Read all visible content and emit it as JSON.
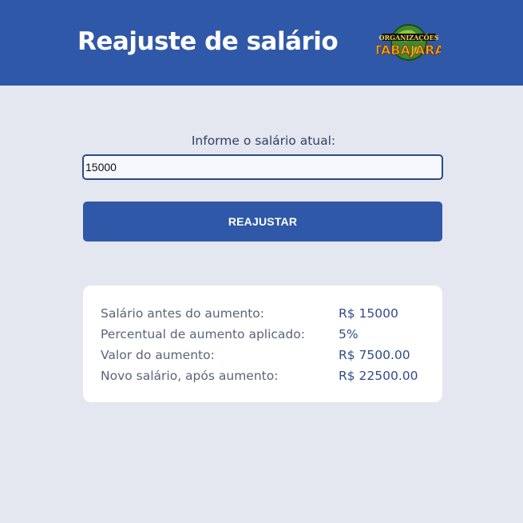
{
  "header": {
    "title": "Reajuste de salário",
    "logo": {
      "icon": "tabajara-logo-icon",
      "line1": "ORGANIZAÇÕES",
      "line2": "TABAJARA"
    }
  },
  "form": {
    "label": "Informe o salário atual:",
    "salary_value": "15000",
    "button_label": "REAJUSTAR"
  },
  "results": [
    {
      "label": "Salário antes do aumento:",
      "value": "R$ 15000"
    },
    {
      "label": "Percentual de aumento aplicado:",
      "value": "5%"
    },
    {
      "label": "Valor do aumento:",
      "value": "R$ 7500.00"
    },
    {
      "label": "Novo salário, após aumento:",
      "value": "R$ 22500.00"
    }
  ],
  "colors": {
    "header_bg": "#3058a8",
    "page_bg": "#e4e7f0",
    "button_bg": "#3058a8",
    "card_bg": "#ffffff"
  }
}
